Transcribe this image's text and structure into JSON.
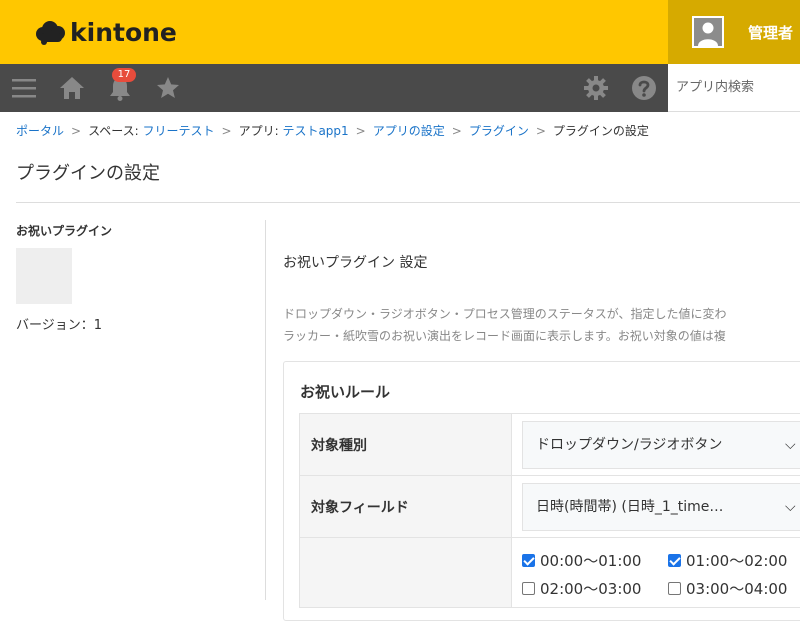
{
  "header": {
    "logo_text": "kintone",
    "user_name": "管理者"
  },
  "nav": {
    "notification_count": "17",
    "search_placeholder": "アプリ内検索"
  },
  "breadcrumb": {
    "portal": "ポータル",
    "space_prefix": "スペース: ",
    "space_name": "フリーテスト",
    "app_prefix": "アプリ: ",
    "app_name": "テストapp1",
    "app_settings": "アプリの設定",
    "plugins": "プラグイン",
    "current": "プラグインの設定",
    "separator": ">"
  },
  "page": {
    "title": "プラグインの設定"
  },
  "plugin": {
    "name": "お祝いプラグイン",
    "version_text": "バージョン：1"
  },
  "settings": {
    "title": "お祝いプラグイン 設定",
    "desc_line1": "ドロップダウン・ラジオボタン・プロセス管理のステータスが、指定した値に変わ",
    "desc_line2": "ラッカー・紙吹雪のお祝い演出をレコード画面に表示します。お祝い対象の値は複",
    "rules_title": "お祝いルール",
    "rows": {
      "target_type_label": "対象種別",
      "target_type_value": "ドロップダウン/ラジオボタン",
      "target_field_label": "対象フィールド",
      "target_field_value": "日時(時間帯) (日時_1_time…"
    },
    "values": [
      {
        "label": "00:00〜01:00",
        "checked": true
      },
      {
        "label": "01:00〜02:00",
        "checked": true
      },
      {
        "label": "02:00〜03:00",
        "checked": false
      },
      {
        "label": "03:00〜04:00",
        "checked": false
      }
    ]
  },
  "colors": {
    "header_bg": "#ffc700",
    "user_area_bg": "#d6aa00",
    "nav_bg": "#4a4a4a",
    "link": "#1a73c8",
    "badge": "#e74c3c"
  }
}
